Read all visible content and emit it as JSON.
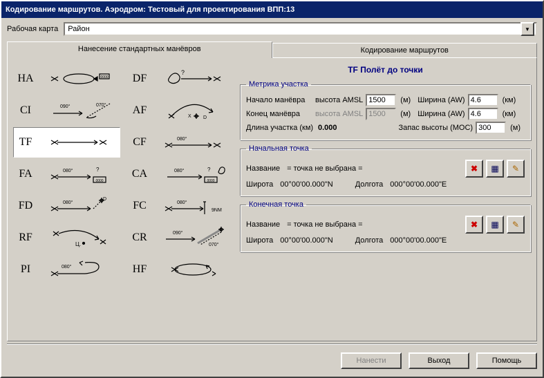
{
  "window": {
    "title": "Кодирование маршрутов. Аэродром: Тестовый для проектирования ВПП:13"
  },
  "workCard": {
    "label": "Рабочая карта",
    "value": "Район"
  },
  "tabs": {
    "maneuvers": "Нанесение стандартных манёвров",
    "routes": "Кодирование маршрутов"
  },
  "maneuvers": [
    {
      "code": "HA"
    },
    {
      "code": "DF"
    },
    {
      "code": "CI"
    },
    {
      "code": "AF"
    },
    {
      "code": "TF",
      "selected": true
    },
    {
      "code": "CF"
    },
    {
      "code": "FA"
    },
    {
      "code": "CA"
    },
    {
      "code": "FD"
    },
    {
      "code": "FC"
    },
    {
      "code": "RF"
    },
    {
      "code": "CR"
    },
    {
      "code": "PI"
    },
    {
      "code": "HF"
    }
  ],
  "details": {
    "title": "TF Полёт до точки",
    "metricGroup": "Метрика участка",
    "startLabel": "Начало манёвра",
    "endLabel": "Конец манёвра",
    "amslLabel": "высота AMSL",
    "amslUnit": "(м)",
    "widthLabel": "Ширина (AW)",
    "widthUnit": "(км)",
    "lengthLabel": "Длина участка (км)",
    "mocLabel": "Запас высоты (MOC)",
    "mocUnit": "(м)",
    "startAmsl": "1500",
    "endAmsl": "1500",
    "startWidth": "4.6",
    "endWidth": "4.6",
    "length": "0.000",
    "moc": "300",
    "startPointGroup": "Начальная точка",
    "endPointGroup": "Конечная точка",
    "nameLabel": "Название",
    "notSelected": "= точка не выбрана =",
    "latLabel": "Широта",
    "lonLabel": "Долгота",
    "lat": "00°00'00.000\"N",
    "lon": "000°00'00.000\"E"
  },
  "buttons": {
    "apply": "Нанести",
    "exit": "Выход",
    "help": "Помощь"
  },
  "icons": {
    "delete": "✖",
    "calendar": "▦",
    "candle": "✎",
    "dropdown": "▼"
  }
}
